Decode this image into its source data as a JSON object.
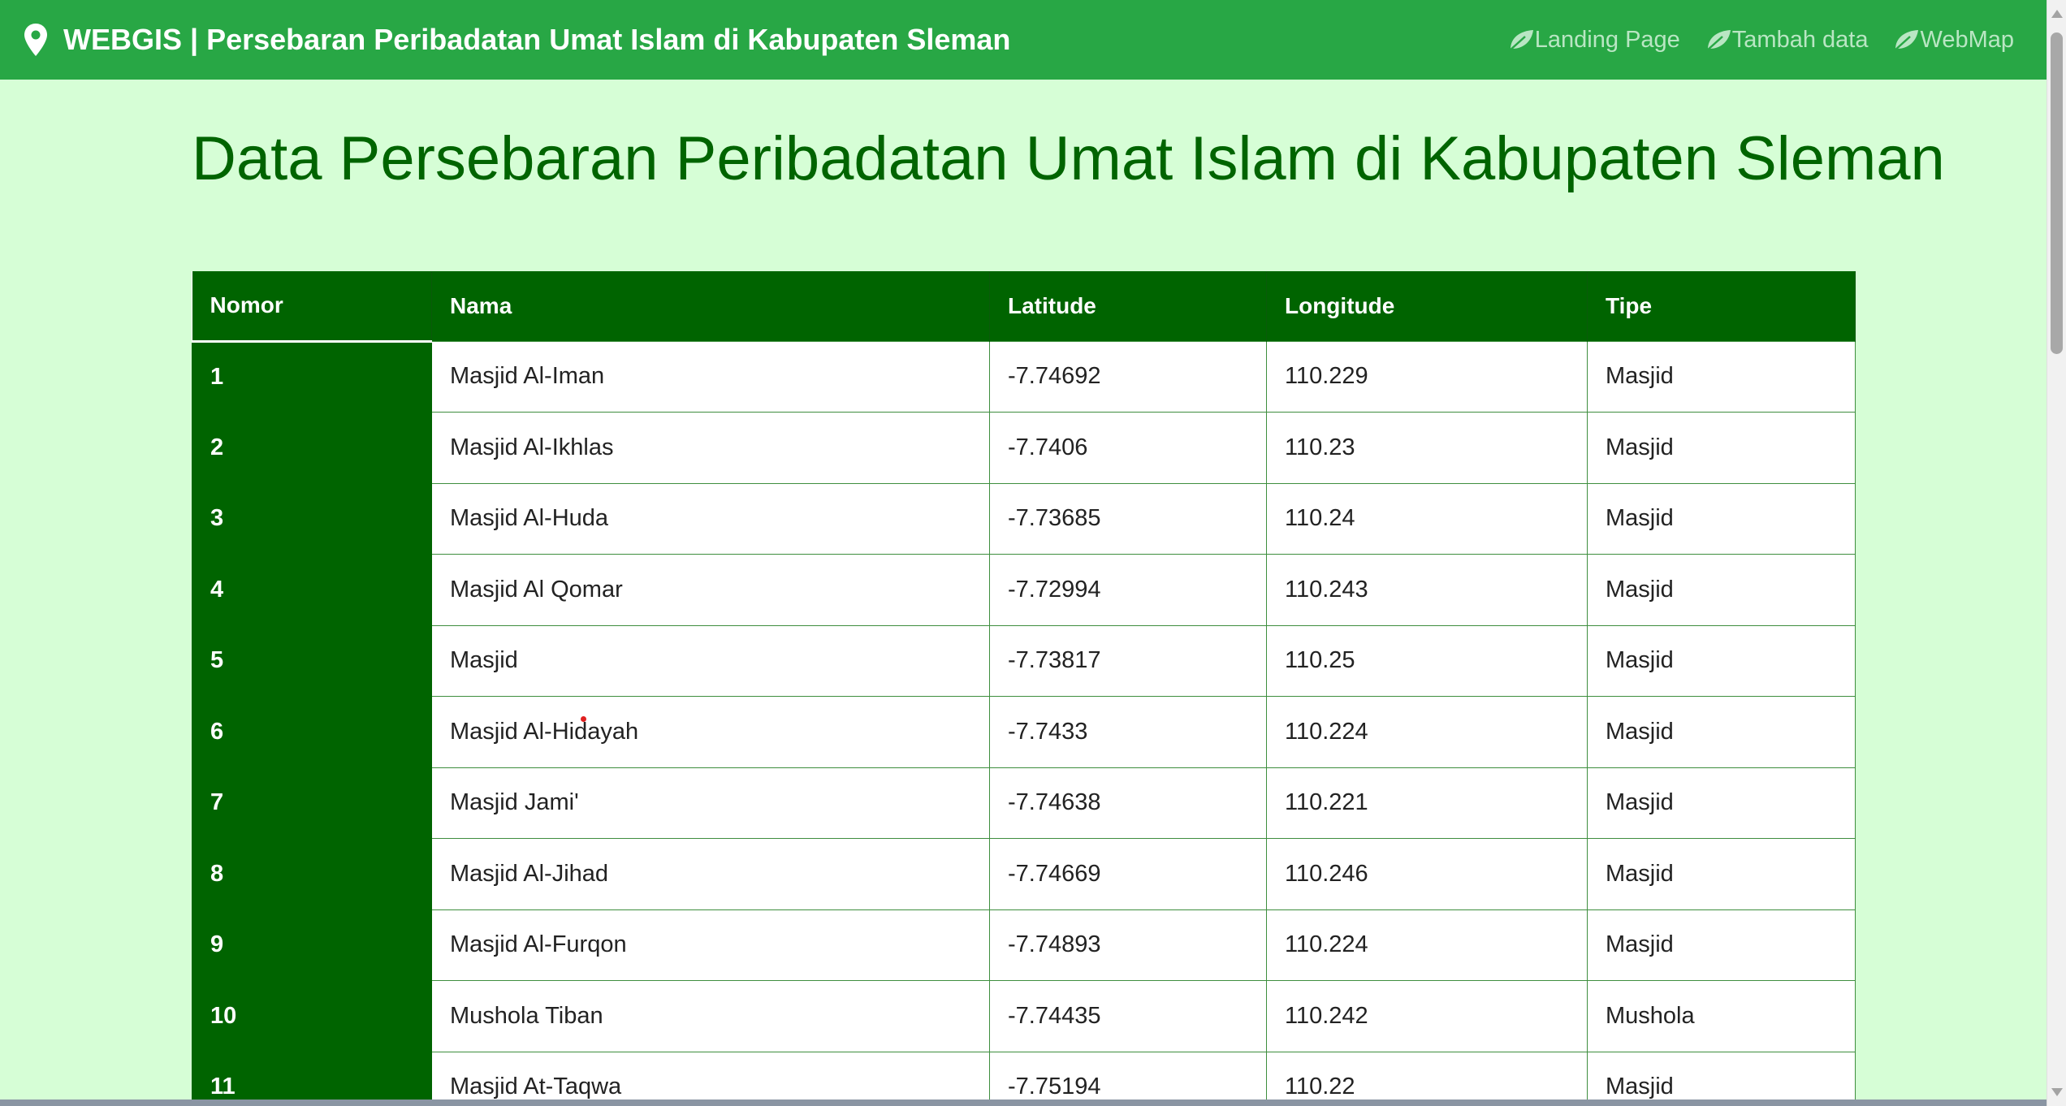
{
  "navbar": {
    "brand": "WEBGIS | Persebaran Peribadatan Umat Islam di Kabupaten Sleman",
    "brand_icon": "map-pin-icon",
    "links": [
      {
        "label": "Landing Page",
        "icon": "leaf-icon"
      },
      {
        "label": "Tambah data",
        "icon": "leaf-icon"
      },
      {
        "label": "WebMap",
        "icon": "leaf-icon"
      }
    ]
  },
  "page": {
    "title": "Data Persebaran Peribadatan Umat Islam di Kabupaten Sleman"
  },
  "table": {
    "headers": [
      "Nomor",
      "Nama",
      "Latitude",
      "Longitude",
      "Tipe"
    ],
    "rows": [
      [
        "1",
        "Masjid Al-Iman",
        "-7.74692",
        "110.229",
        "Masjid"
      ],
      [
        "2",
        "Masjid Al-Ikhlas",
        "-7.7406",
        "110.23",
        "Masjid"
      ],
      [
        "3",
        "Masjid Al-Huda",
        "-7.73685",
        "110.24",
        "Masjid"
      ],
      [
        "4",
        "Masjid Al Qomar",
        "-7.72994",
        "110.243",
        "Masjid"
      ],
      [
        "5",
        "Masjid",
        "-7.73817",
        "110.25",
        "Masjid"
      ],
      [
        "6",
        "Masjid Al-Hidayah",
        "-7.7433",
        "110.224",
        "Masjid"
      ],
      [
        "7",
        "Masjid Jami'",
        "-7.74638",
        "110.221",
        "Masjid"
      ],
      [
        "8",
        "Masjid Al-Jihad",
        "-7.74669",
        "110.246",
        "Masjid"
      ],
      [
        "9",
        "Masjid Al-Furqon",
        "-7.74893",
        "110.224",
        "Masjid"
      ],
      [
        "10",
        "Mushola Tiban",
        "-7.74435",
        "110.242",
        "Mushola"
      ],
      [
        "11",
        "Masjid At-Taqwa",
        "-7.75194",
        "110.22",
        "Masjid"
      ]
    ]
  },
  "colors": {
    "navbar": "#28a745",
    "background": "#d6fed6",
    "accent": "#006400"
  }
}
